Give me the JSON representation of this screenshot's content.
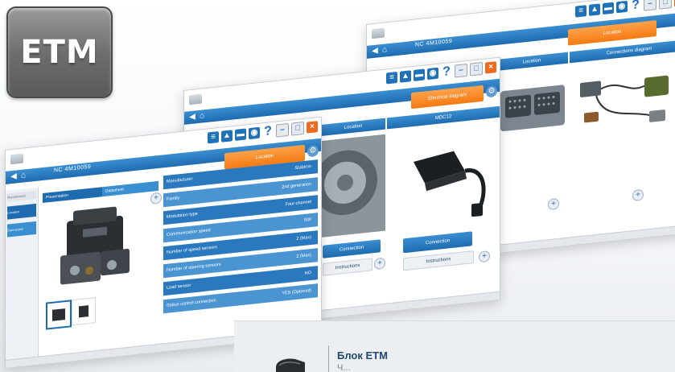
{
  "logo": {
    "text": "ETM"
  },
  "windows": {
    "front": {
      "title": "NC 4M10059",
      "orange_label": "Location",
      "tabs": [
        "Presentation",
        "Datasheet"
      ],
      "side_items": [
        "Manufacturer",
        "Location",
        "Connection"
      ],
      "table": [
        {
          "k": "Manufacturer",
          "v": "Stabiron"
        },
        {
          "k": "Family",
          "v": "2nd generation"
        },
        {
          "k": "Modulation type",
          "v": "Four-channel"
        },
        {
          "k": "Communication speed",
          "v": "500"
        },
        {
          "k": "Number of speed sensors",
          "v": "2 (Max)"
        },
        {
          "k": "Number of steering sensors",
          "v": "2 (Max)"
        },
        {
          "k": "Load sensor",
          "v": "NO"
        },
        {
          "k": "Status control connection",
          "v": "YES (Optional)"
        }
      ]
    },
    "middle": {
      "orange_label": "Electrical diagram",
      "panel_right_title": "MDC12",
      "panel_left_title": "Location",
      "btn_left": "Connection",
      "btn_left2": "Instructions",
      "btn_right": "Connection",
      "btn_right2": "Instructions"
    },
    "back": {
      "title": "NC 4M10059",
      "orange_label": "Location",
      "panel_left_title": "Location",
      "panel_right_title": "Connections diagram"
    }
  },
  "card": {
    "name": "Блок ETM",
    "desc": "Ч..."
  },
  "colors": {
    "accent_blue": "#1f6bb0",
    "accent_orange": "#f47a12",
    "card_title": "#24476b"
  }
}
